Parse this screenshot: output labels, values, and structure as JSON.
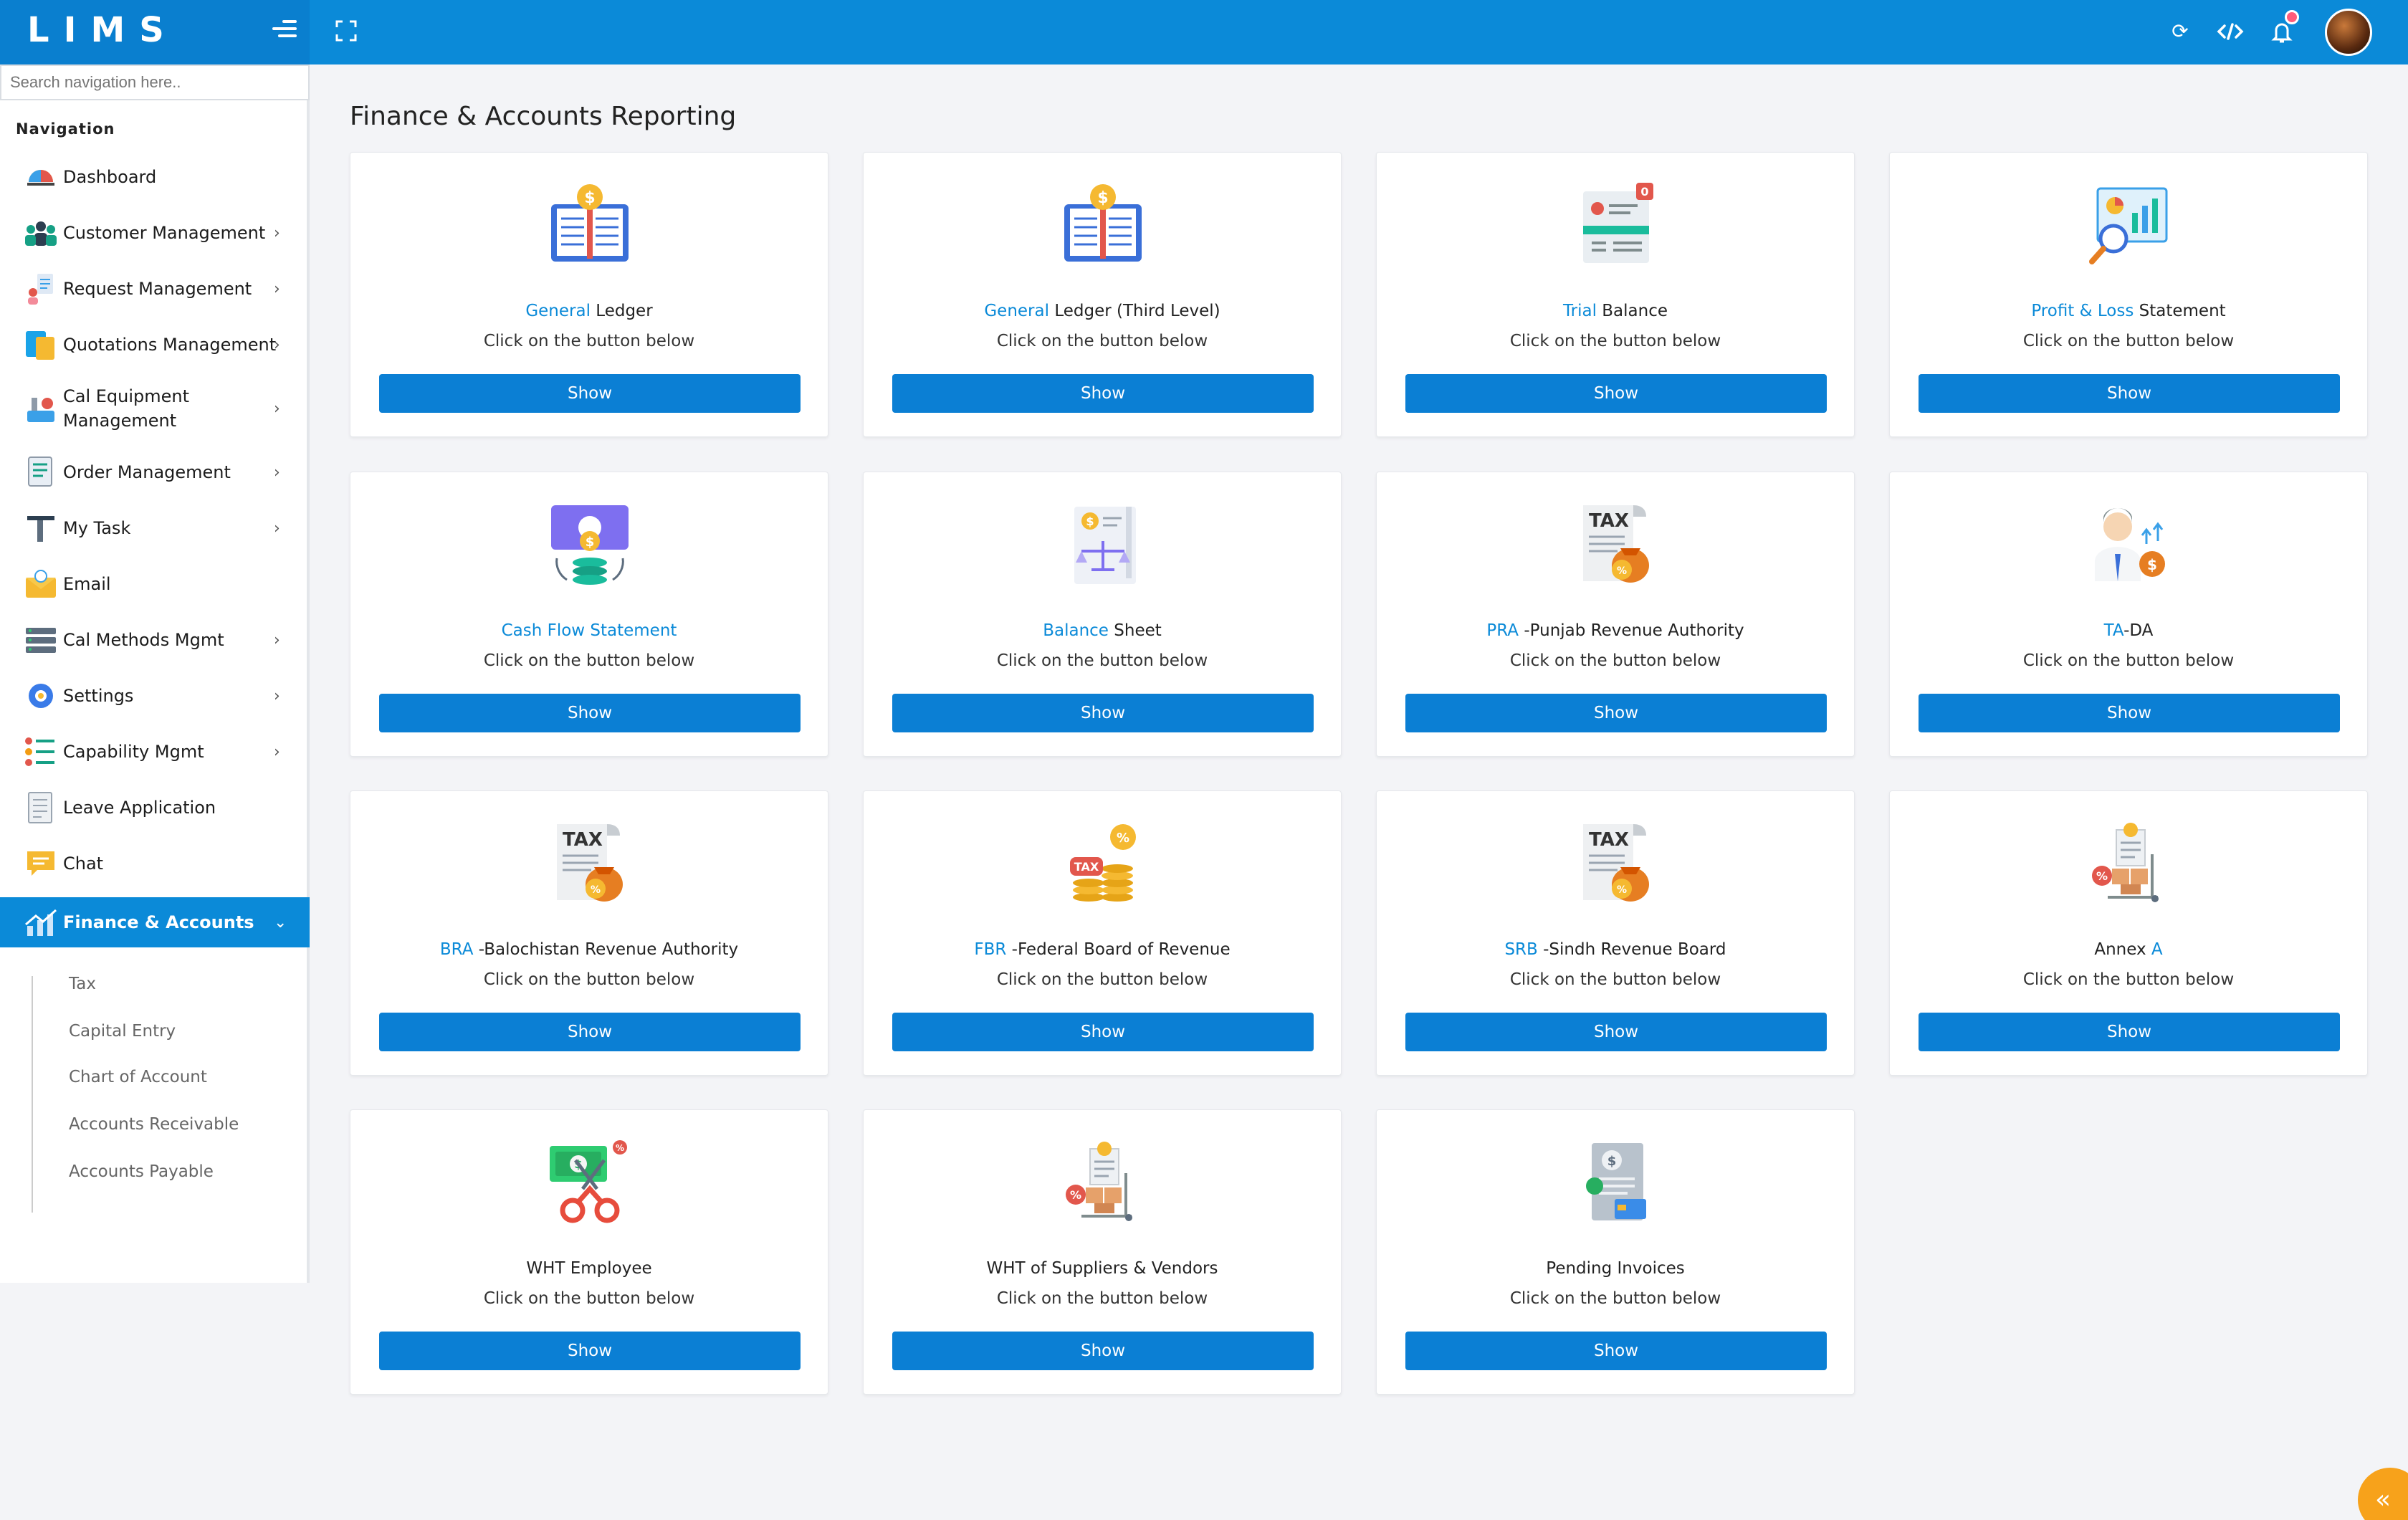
{
  "app": {
    "logo": "LIMS"
  },
  "search": {
    "placeholder": "Search navigation here.."
  },
  "nav": {
    "title": "Navigation",
    "items": [
      {
        "label": "Dashboard",
        "icon": "dashboard-icon",
        "chevron": ""
      },
      {
        "label": "Customer Management",
        "icon": "customers-icon",
        "chevron": "›"
      },
      {
        "label": "Request Management",
        "icon": "request-icon",
        "chevron": "›"
      },
      {
        "label": "Quotations Management",
        "icon": "quotation-icon",
        "chevron": "›"
      },
      {
        "label": "Cal Equipment Management",
        "icon": "equipment-icon",
        "chevron": "›"
      },
      {
        "label": "Order Management",
        "icon": "order-icon",
        "chevron": "›"
      },
      {
        "label": "My Task",
        "icon": "task-icon",
        "chevron": "›"
      },
      {
        "label": "Email",
        "icon": "email-icon",
        "chevron": ""
      },
      {
        "label": "Cal Methods Mgmt",
        "icon": "methods-icon",
        "chevron": "›"
      },
      {
        "label": "Settings",
        "icon": "settings-icon",
        "chevron": "›"
      },
      {
        "label": "Capability Mgmt",
        "icon": "capability-icon",
        "chevron": "›"
      },
      {
        "label": "Leave Application",
        "icon": "leave-icon",
        "chevron": ""
      },
      {
        "label": "Chat",
        "icon": "chat-icon",
        "chevron": ""
      },
      {
        "label": "Finance & Accounts",
        "icon": "finance-icon",
        "chevron": "⌄"
      }
    ],
    "sub_items": [
      "Tax",
      "Capital Entry",
      "Chart of Account",
      "Accounts Receivable",
      "Accounts Payable"
    ]
  },
  "page": {
    "title": "Finance & Accounts Reporting"
  },
  "cards": [
    {
      "hl": "General",
      "rest": " Ledger",
      "sub": "Click on the button below",
      "btn": "Show",
      "icon": "ledger-book-icon"
    },
    {
      "hl": "General",
      "rest": " Ledger (Third Level)",
      "sub": "Click on the button below",
      "btn": "Show",
      "icon": "ledger-book-icon"
    },
    {
      "hl": "Trial",
      "rest": " Balance",
      "sub": "Click on the button below",
      "btn": "Show",
      "icon": "trial-balance-icon"
    },
    {
      "hl": "Profit & Loss",
      "rest": " Statement",
      "sub": "Click on the button below",
      "btn": "Show",
      "icon": "profit-loss-icon"
    },
    {
      "hl": "Cash Flow Statement",
      "rest": "",
      "sub": "Click on the button below",
      "btn": "Show",
      "icon": "cash-flow-icon"
    },
    {
      "hl": "Balance",
      "rest": " Sheet",
      "sub": "Click on the button below",
      "btn": "Show",
      "icon": "balance-sheet-icon"
    },
    {
      "hl": "PRA",
      "rest": " -Punjab Revenue Authority",
      "sub": "Click on the button below",
      "btn": "Show",
      "icon": "tax-document-icon"
    },
    {
      "hl": "TA",
      "rest": "-DA",
      "sub": "Click on the button below",
      "btn": "Show",
      "icon": "allowance-icon"
    },
    {
      "hl": "BRA",
      "rest": " -Balochistan Revenue Authority",
      "sub": "Click on the button below",
      "btn": "Show",
      "icon": "tax-document-icon"
    },
    {
      "hl": "FBR",
      "rest": " -Federal Board of Revenue",
      "sub": "Click on the button below",
      "btn": "Show",
      "icon": "tax-coins-icon"
    },
    {
      "hl": "SRB",
      "rest": " -Sindh Revenue Board",
      "sub": "Click on the button below",
      "btn": "Show",
      "icon": "tax-document-icon"
    },
    {
      "hl": "",
      "rest": "Annex ",
      "hl2": "A",
      "sub": "Click on the button below",
      "btn": "Show",
      "icon": "annex-cart-icon"
    },
    {
      "hl": "",
      "rest": "WHT Employee",
      "sub": "Click on the button below",
      "btn": "Show",
      "icon": "wht-employee-icon"
    },
    {
      "hl": "",
      "rest": "WHT of Suppliers & Vendors",
      "sub": "Click on the button below",
      "btn": "Show",
      "icon": "wht-suppliers-icon"
    },
    {
      "hl": "",
      "rest": "Pending Invoices",
      "sub": "Click on the button below",
      "btn": "Show",
      "icon": "pending-invoice-icon"
    }
  ],
  "colors": {
    "primary": "#0b8ad8",
    "button": "#0b7fd4",
    "fab": "#f7a21b"
  }
}
